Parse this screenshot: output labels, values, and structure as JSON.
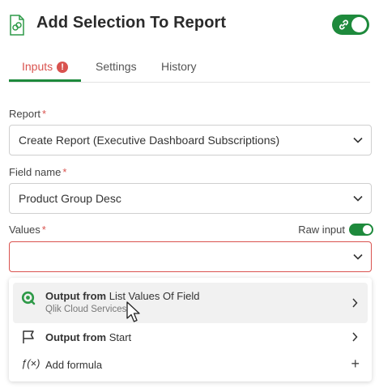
{
  "header": {
    "title": "Add Selection To Report",
    "block_icon": "report-block-icon",
    "toggle_icon": "link-icon",
    "accent_color": "#1e8a3c"
  },
  "tabs": [
    {
      "label": "Inputs",
      "active": true,
      "has_error": true,
      "error_glyph": "!"
    },
    {
      "label": "Settings",
      "active": false
    },
    {
      "label": "History",
      "active": false
    }
  ],
  "fields": {
    "report": {
      "label": "Report",
      "required": "*",
      "value": "Create Report (Executive Dashboard Subscriptions)"
    },
    "field_name": {
      "label": "Field name",
      "required": "*",
      "value": "Product Group Desc"
    },
    "values": {
      "label": "Values",
      "required": "*",
      "value": "",
      "raw_input_label": "Raw input",
      "raw_input_on": true
    }
  },
  "dropdown": {
    "options": [
      {
        "prefix": "Output from",
        "target": "List Values Of Field",
        "subtitle": "Qlik Cloud Services",
        "icon": "qlik-icon"
      },
      {
        "prefix": "Output from",
        "target": "Start",
        "icon": "flag-icon"
      },
      {
        "label": "Add formula",
        "icon": "formula-icon",
        "action_glyph": "+"
      }
    ]
  },
  "colors": {
    "error": "#d9534f",
    "accent": "#1e8a3c"
  }
}
